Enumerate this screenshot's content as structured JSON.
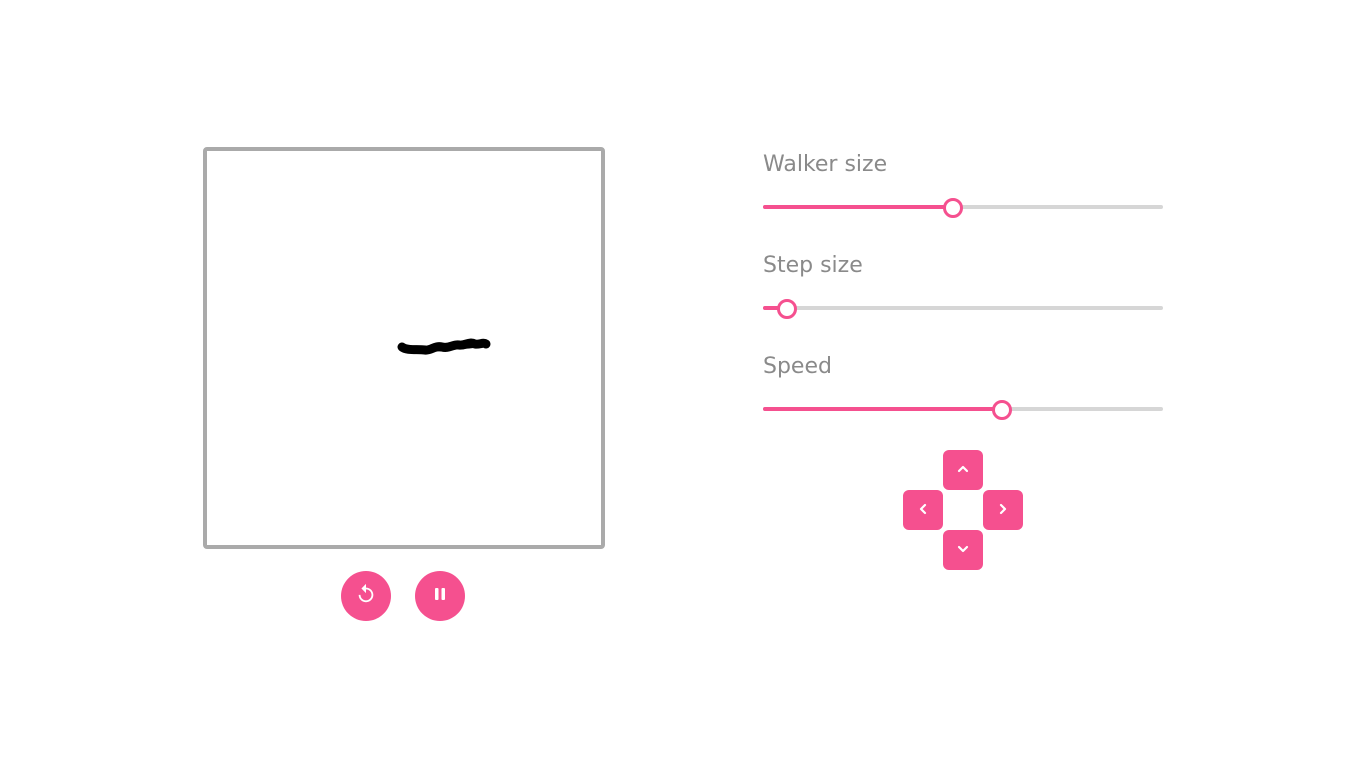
{
  "canvas": {
    "stroke_color": "#000000",
    "border_color": "#aaaaaa"
  },
  "playback": {
    "reset_icon": "restart-icon",
    "pause_icon": "pause-icon"
  },
  "controls": {
    "walker_size": {
      "label": "Walker size",
      "value_fraction": 0.475
    },
    "step_size": {
      "label": "Step size",
      "value_fraction": 0.06
    },
    "speed": {
      "label": "Speed",
      "value_fraction": 0.597
    }
  },
  "dpad": {
    "up_icon": "chevron-up-icon",
    "left_icon": "chevron-left-icon",
    "right_icon": "chevron-right-icon",
    "down_icon": "chevron-down-icon"
  },
  "theme": {
    "accent": "#f5508f",
    "track": "#d6d6d6",
    "label": "#8a8a8a"
  }
}
